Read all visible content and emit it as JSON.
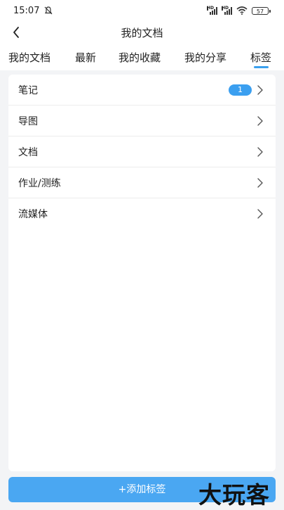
{
  "status_bar": {
    "time": "15:07",
    "battery": "57",
    "network_label": "HD"
  },
  "nav": {
    "title": "我的文档"
  },
  "tabs": [
    {
      "label": "我的文档"
    },
    {
      "label": "最新"
    },
    {
      "label": "我的收藏"
    },
    {
      "label": "我的分享"
    },
    {
      "label": "标签",
      "active": true
    }
  ],
  "tag_list": [
    {
      "label": "笔记",
      "badge": "1"
    },
    {
      "label": "导图"
    },
    {
      "label": "文档"
    },
    {
      "label": "作业/测练"
    },
    {
      "label": "流媒体"
    }
  ],
  "add_button": {
    "label": "+添加标签"
  },
  "watermark": "大玩客",
  "colors": {
    "accent": "#3aa0ee",
    "button": "#4aa7f2",
    "background": "#f3f4f6"
  }
}
